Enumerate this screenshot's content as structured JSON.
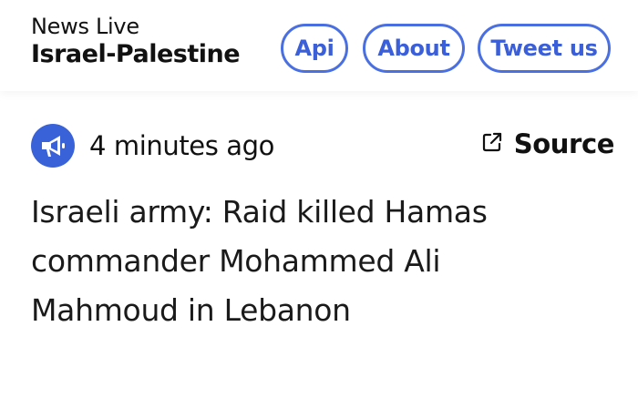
{
  "header": {
    "brand_top": "News Live",
    "brand_bottom": "Israel-Palestine"
  },
  "nav": {
    "api_label": "Api",
    "about_label": "About",
    "tweet_label": "Tweet us"
  },
  "post": {
    "icon": "megaphone-icon",
    "timestamp": "4 minutes ago",
    "source_label": "Source",
    "source_icon": "external-link-icon",
    "headline": "Israeli army: Raid killed Hamas commander Mohammed Ali Mahmoud in Lebanon"
  },
  "colors": {
    "accent": "#3a62d8",
    "text": "#111111",
    "background": "#ffffff"
  }
}
